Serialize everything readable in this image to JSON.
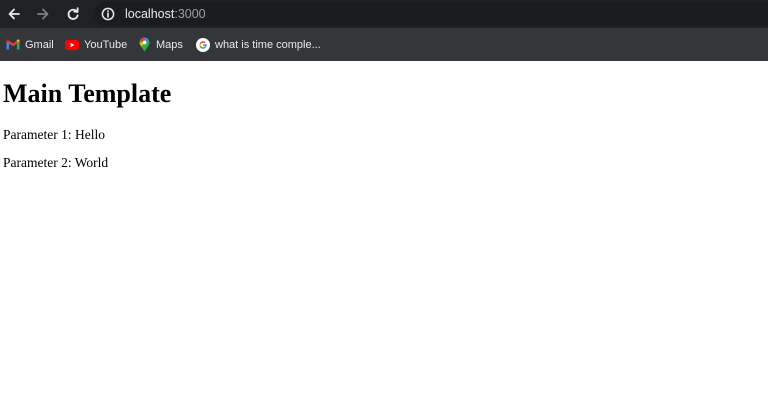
{
  "browser": {
    "url_host": "localhost",
    "url_port": ":3000",
    "icons": {
      "back": "back-arrow-icon",
      "forward": "forward-arrow-icon",
      "reload": "reload-icon",
      "site_info": "info-icon"
    }
  },
  "bookmarks": [
    {
      "label": "Gmail",
      "icon": "gmail-icon"
    },
    {
      "label": "YouTube",
      "icon": "youtube-icon"
    },
    {
      "label": "Maps",
      "icon": "maps-icon"
    },
    {
      "label": "what is time comple...",
      "icon": "google-icon"
    }
  ],
  "page": {
    "title": "Main Template",
    "param1": "Parameter 1: Hello",
    "param2": "Parameter 2: World"
  },
  "colors": {
    "toolbar_bg": "#202124",
    "bookmarks_bg": "#35363a",
    "page_bg": "#ffffff"
  }
}
